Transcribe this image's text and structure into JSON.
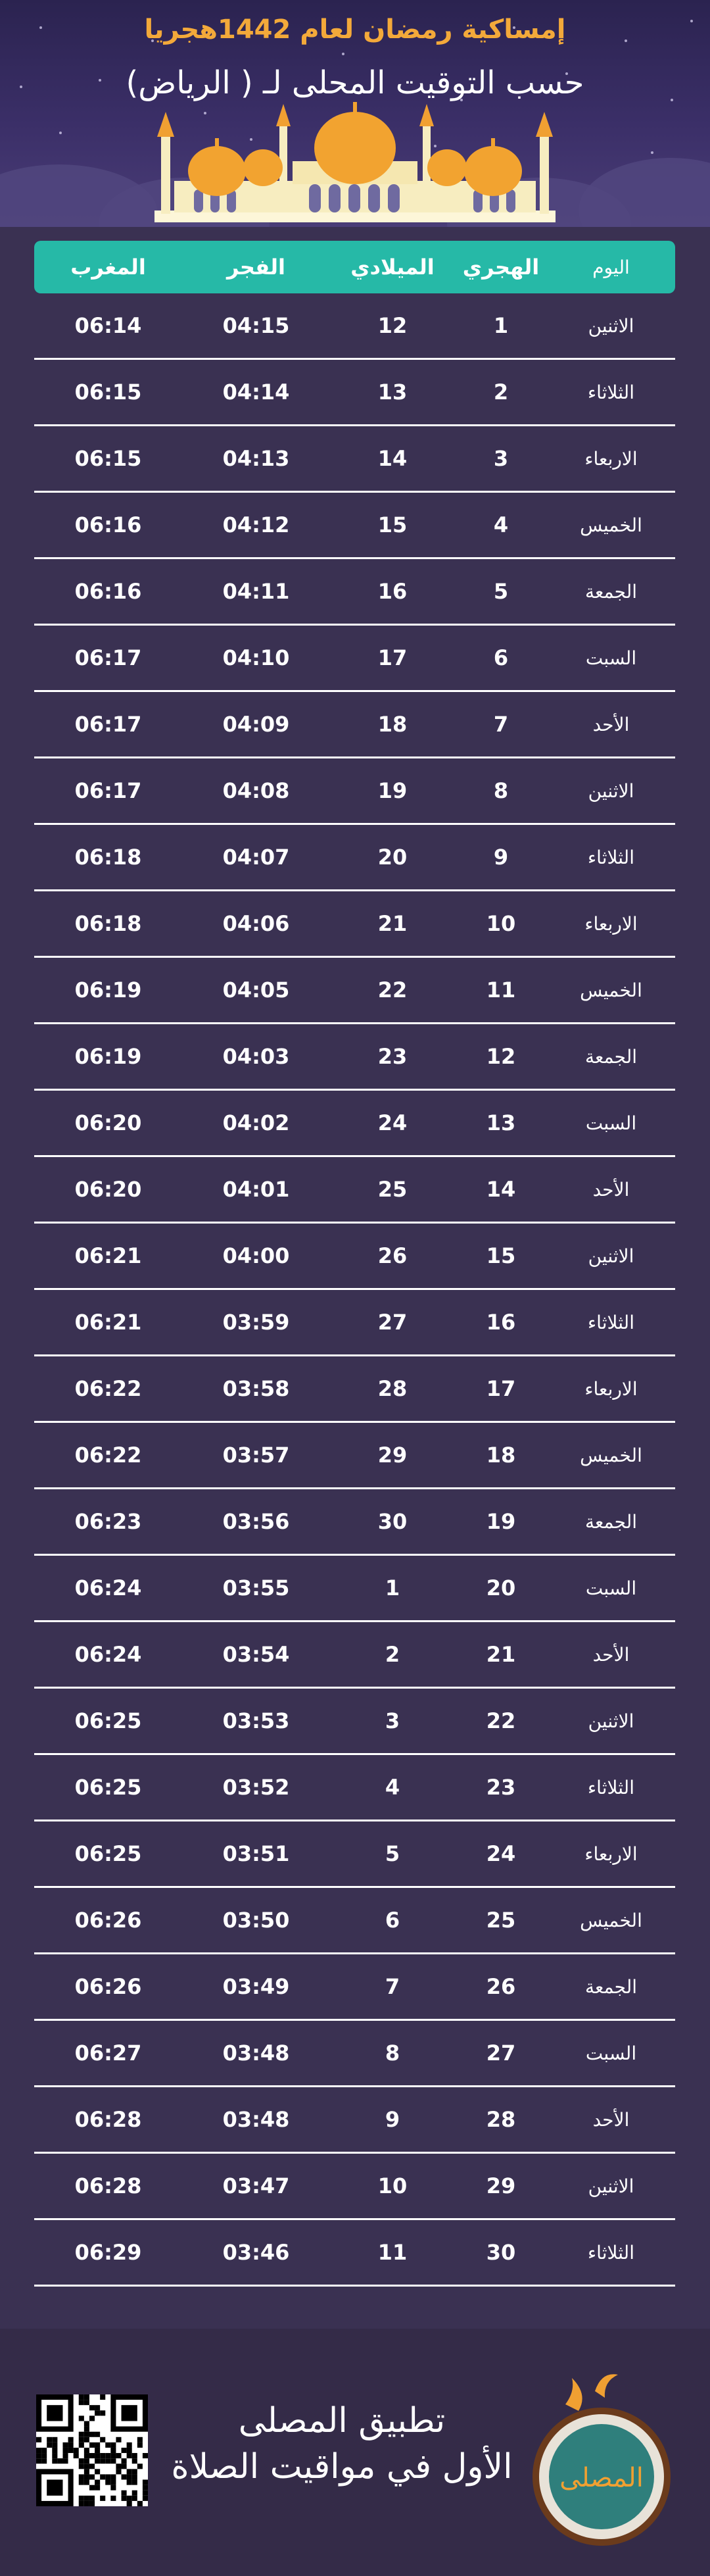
{
  "header": {
    "title": "إمساكية رمضان لعام 1442هجريا",
    "subtitle": "حسب التوقيت المحلى لـ ( الرياض)"
  },
  "table": {
    "headers": [
      "اليوم",
      "الهجري",
      "الميلادي",
      "الفجر",
      "المغرب"
    ],
    "rows": [
      [
        "الاثنين",
        "1",
        "12",
        "04:15",
        "06:14"
      ],
      [
        "الثلاثاء",
        "2",
        "13",
        "04:14",
        "06:15"
      ],
      [
        "الاربعاء",
        "3",
        "14",
        "04:13",
        "06:15"
      ],
      [
        "الخميس",
        "4",
        "15",
        "04:12",
        "06:16"
      ],
      [
        "الجمعة",
        "5",
        "16",
        "04:11",
        "06:16"
      ],
      [
        "السبت",
        "6",
        "17",
        "04:10",
        "06:17"
      ],
      [
        "الأحد",
        "7",
        "18",
        "04:09",
        "06:17"
      ],
      [
        "الاثنين",
        "8",
        "19",
        "04:08",
        "06:17"
      ],
      [
        "الثلاثاء",
        "9",
        "20",
        "04:07",
        "06:18"
      ],
      [
        "الاربعاء",
        "10",
        "21",
        "04:06",
        "06:18"
      ],
      [
        "الخميس",
        "11",
        "22",
        "04:05",
        "06:19"
      ],
      [
        "الجمعة",
        "12",
        "23",
        "04:03",
        "06:19"
      ],
      [
        "السبت",
        "13",
        "24",
        "04:02",
        "06:20"
      ],
      [
        "الأحد",
        "14",
        "25",
        "04:01",
        "06:20"
      ],
      [
        "الاثنين",
        "15",
        "26",
        "04:00",
        "06:21"
      ],
      [
        "الثلاثاء",
        "16",
        "27",
        "03:59",
        "06:21"
      ],
      [
        "الاربعاء",
        "17",
        "28",
        "03:58",
        "06:22"
      ],
      [
        "الخميس",
        "18",
        "29",
        "03:57",
        "06:22"
      ],
      [
        "الجمعة",
        "19",
        "30",
        "03:56",
        "06:23"
      ],
      [
        "السبت",
        "20",
        "1",
        "03:55",
        "06:24"
      ],
      [
        "الأحد",
        "21",
        "2",
        "03:54",
        "06:24"
      ],
      [
        "الاثنين",
        "22",
        "3",
        "03:53",
        "06:25"
      ],
      [
        "الثلاثاء",
        "23",
        "4",
        "03:52",
        "06:25"
      ],
      [
        "الاربعاء",
        "24",
        "5",
        "03:51",
        "06:25"
      ],
      [
        "الخميس",
        "25",
        "6",
        "03:50",
        "06:26"
      ],
      [
        "الجمعة",
        "26",
        "7",
        "03:49",
        "06:26"
      ],
      [
        "السبت",
        "27",
        "8",
        "03:48",
        "06:27"
      ],
      [
        "الأحد",
        "28",
        "9",
        "03:48",
        "06:28"
      ],
      [
        "الاثنين",
        "29",
        "10",
        "03:47",
        "06:28"
      ],
      [
        "الثلاثاء",
        "30",
        "11",
        "03:46",
        "06:29"
      ]
    ]
  },
  "footer": {
    "app_name": "تطبيق المصلى",
    "app_tagline": "الأول في مواقيت الصلاة",
    "logo_text": "المصلى"
  },
  "icons": {
    "mosque": "mosque-illustration",
    "qr": "qr-code-icon",
    "logo": "app-logo-icon"
  },
  "colors": {
    "title": "#f3a93a",
    "header_bar": "#26b9a7",
    "background": "#3a3152",
    "footer": "#342b48"
  }
}
